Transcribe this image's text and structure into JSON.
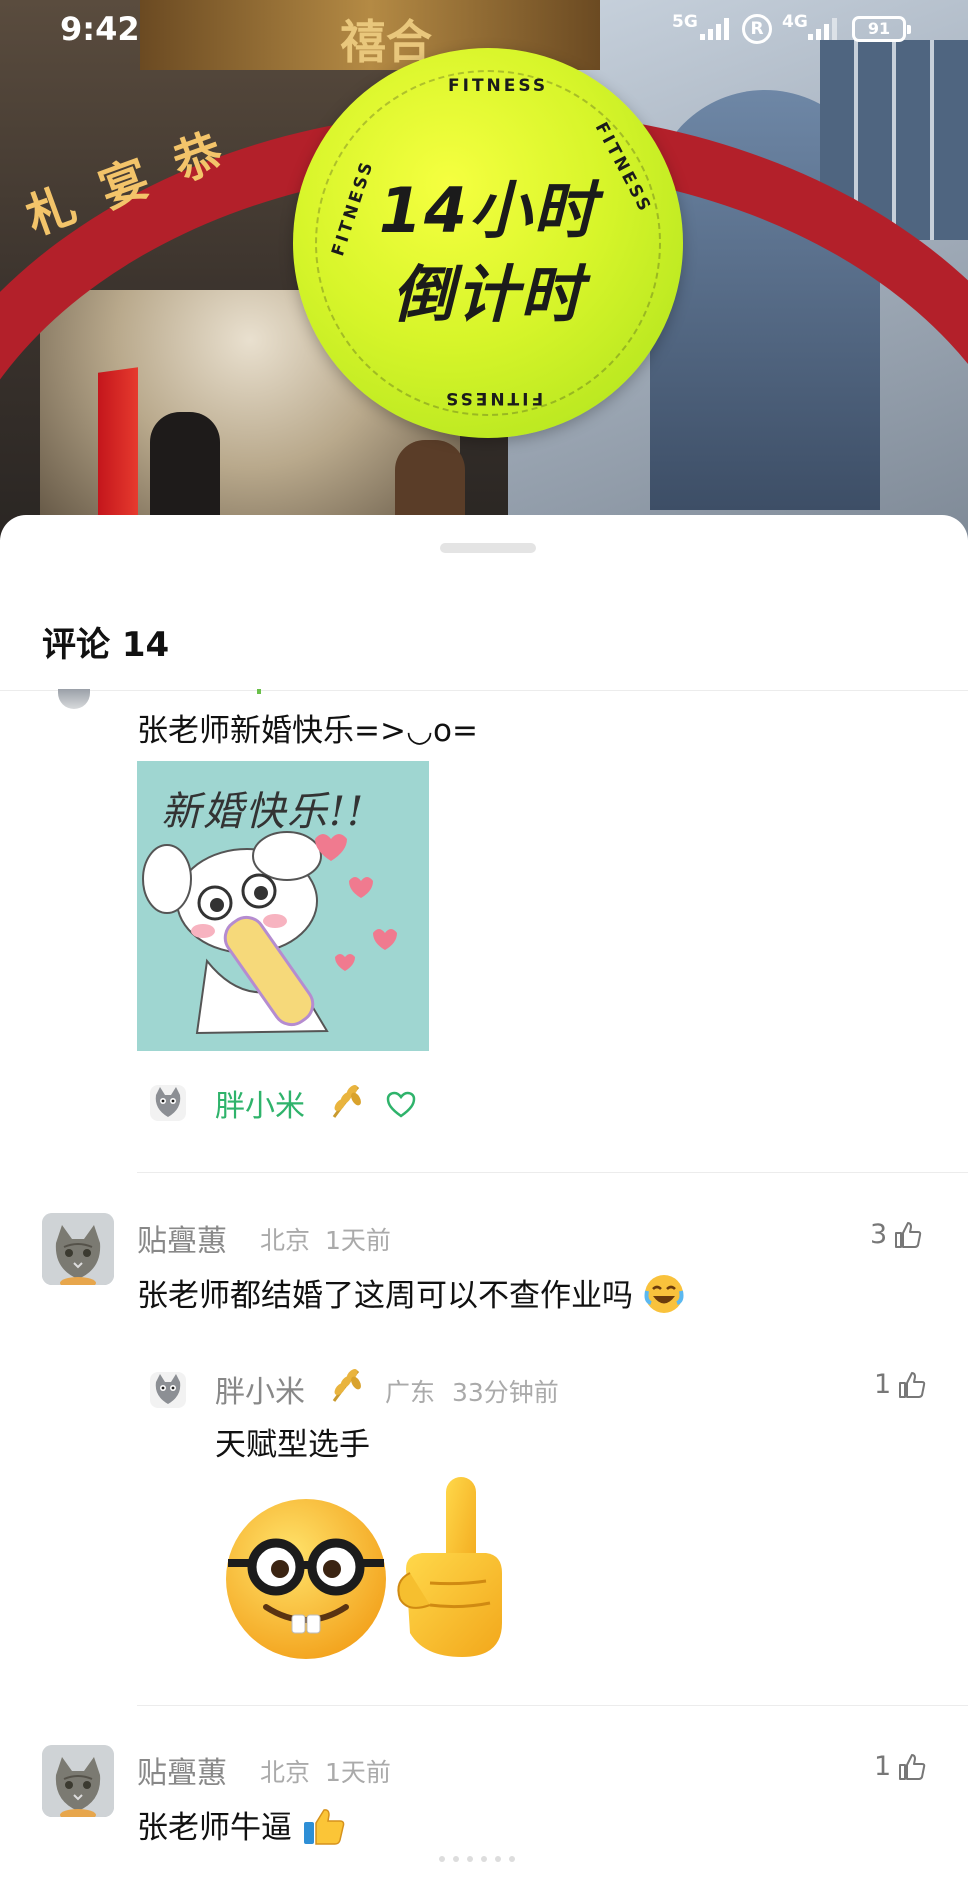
{
  "status_bar": {
    "time": "9:42",
    "net1": "5G",
    "net2": "4G",
    "roaming": "R",
    "battery": "91"
  },
  "video": {
    "badge_line1": "14小时",
    "badge_line2": "倒计时",
    "badge_ring_text": "FITNESS",
    "arch_text_left": "札宴恭",
    "sign_text": "禧合"
  },
  "comments_sheet": {
    "title": "评论 14",
    "items": [
      {
        "text": "张老师新婚快乐=>◡o=",
        "sticker_text": "新婚快乐!!",
        "liked_by": "胖小米"
      },
      {
        "user": "贴亹蕙",
        "location": "北京",
        "time": "1天前",
        "likes": "3",
        "text": "张老师都结婚了这周可以不查作业吗",
        "reply": {
          "user": "胖小米",
          "location": "广东",
          "time": "33分钟前",
          "likes": "1",
          "text": "天赋型选手"
        }
      },
      {
        "user": "贴亹蕙",
        "location": "北京",
        "time": "1天前",
        "likes": "1",
        "text": "张老师牛逼"
      }
    ]
  },
  "colors": {
    "accent_green": "#2fb36b",
    "badge_yellow": "#d7f52a",
    "arch_red": "#b3202a"
  },
  "icons": {
    "like": "thumbs-up-outline-icon",
    "heart": "heart-outline-icon",
    "rice": "rice-ear-icon"
  }
}
